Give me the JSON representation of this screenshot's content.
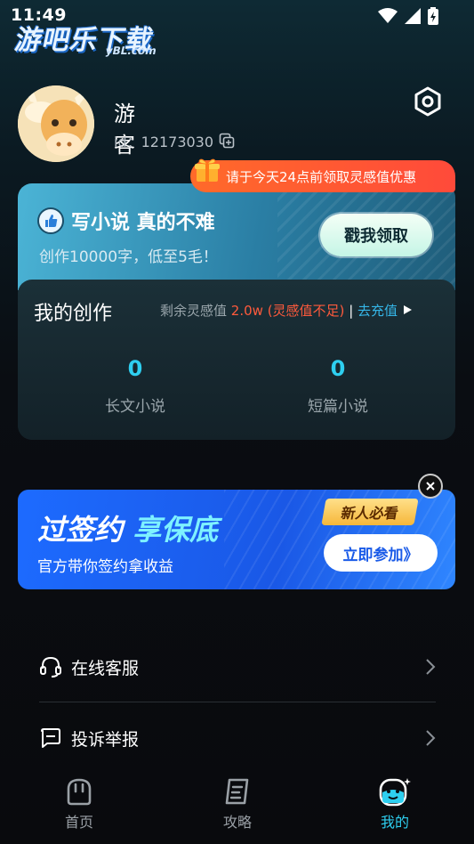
{
  "status_bar": {
    "time": "11:49"
  },
  "watermark": {
    "main": "游吧乐下载",
    "sub": "yBL.com"
  },
  "profile": {
    "name": "游客",
    "id_text": "id：12173030"
  },
  "promo_tag": "请于今天24点前领取灵感值优惠",
  "write_card": {
    "title": "写小说 真的不难",
    "subtitle": "创作10000字，低至5毛！",
    "button": "戳我领取"
  },
  "works": {
    "title": "我的创作",
    "remain_label": "剩余灵感值",
    "remain_value": "2.0w (灵感值不足)",
    "separator": "|",
    "recharge": "去充值",
    "stats": [
      {
        "count": "0",
        "label": "长文小说"
      },
      {
        "count": "0",
        "label": "短篇小说"
      }
    ]
  },
  "banner": {
    "title_a": "过签约",
    "title_b": "享保底",
    "subtitle": "官方带你签约拿收益",
    "badge": "新人必看",
    "button": "立即参加》"
  },
  "menu": [
    {
      "label": "在线客服"
    },
    {
      "label": "投诉举报"
    }
  ],
  "tabs": [
    {
      "label": "首页"
    },
    {
      "label": "攻略"
    },
    {
      "label": "我的"
    }
  ],
  "colors": {
    "accent": "#2ecff0",
    "warning": "#ff5a3c",
    "link": "#35b6e8",
    "banner": "#1d6bff"
  }
}
